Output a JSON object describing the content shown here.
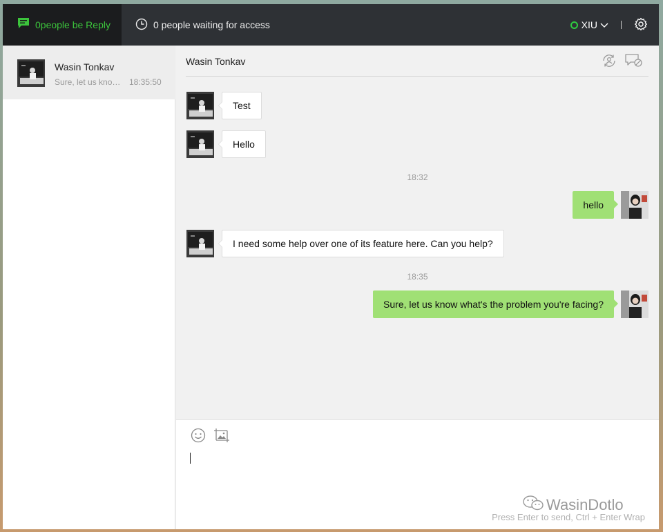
{
  "topbar": {
    "reply_label": "0people be Reply",
    "waiting_label": "0 people waiting for access",
    "user_name": "XIU"
  },
  "sidebar": {
    "conversations": [
      {
        "name": "Wasin Tonkav",
        "preview": "Sure, let us know what's the problem you're facing?",
        "time": "18:35:50"
      }
    ]
  },
  "chat": {
    "title": "Wasin Tonkav",
    "messages": [
      {
        "dir": "in",
        "text": "Test"
      },
      {
        "dir": "in",
        "text": "Hello"
      },
      {
        "dir": "time",
        "text": "18:32"
      },
      {
        "dir": "out",
        "text": "hello"
      },
      {
        "dir": "in",
        "text": "I need some help over one of its feature here. Can you help?"
      },
      {
        "dir": "time",
        "text": "18:35"
      },
      {
        "dir": "out",
        "text": "Sure, let us know what's the problem you're facing?"
      }
    ]
  },
  "composer": {
    "hint": "Press Enter to send, Ctrl + Enter Wrap",
    "watermark": "WasinDotlo"
  },
  "colors": {
    "topbar": "#2e3135",
    "accent_green": "#3cc43c",
    "out_bubble": "#a0e075"
  },
  "icons": {
    "reply": "chat-icon",
    "waiting": "clock-icon",
    "settings": "gear-icon",
    "transfer": "transfer-user-icon",
    "end": "end-chat-icon",
    "emoji": "emoji-icon",
    "image": "image-icon"
  }
}
